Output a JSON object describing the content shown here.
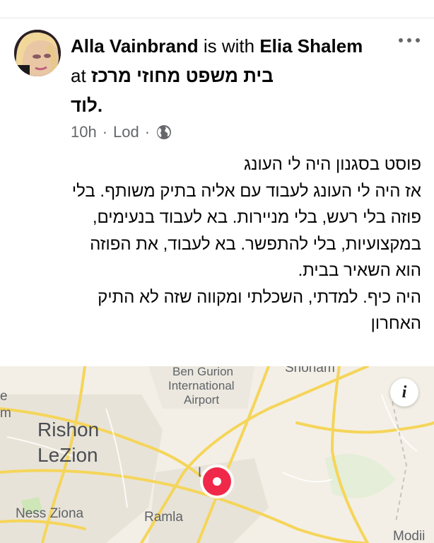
{
  "post": {
    "author": "Alla Vainbrand",
    "is_with": "is with",
    "tagged": "Elia Shalem",
    "at": "at",
    "place_line1": "בית משפט מחוזי מרכז",
    "place_line2": "לוד",
    "place_suffix": ".",
    "time": "10h",
    "separator": "·",
    "location": "Lod",
    "privacy_icon": "globe-icon",
    "body_lines": [
      "פוסט בסגנון היה לי העונג",
      "אז היה לי העונג לעבוד עם אליה בתיק משותף. בלי",
      "פוזה בלי רעש, בלי מניירות. בא לעבוד בנעימים,",
      "במקצועיות, בלי להתפשר. בא לעבוד, את הפוזה",
      "הוא השאיר בבית.",
      "היה כיף. למדתי, השכלתי ומקווה שזה לא התיק",
      "האחרון"
    ]
  },
  "map": {
    "labels": {
      "ben_gurion_1": "Ben Gurion",
      "ben_gurion_2": "International",
      "ben_gurion_3": "Airport",
      "shoham": "Shoham",
      "rishon_1": "Rishon",
      "rishon_2": "LeZion",
      "ness_ziona": "Ness Ziona",
      "ramla": "Ramla",
      "lod": "L",
      "modiin": "Modii",
      "edge_e": "e",
      "edge_m": "m"
    },
    "info_button": "i",
    "colors": {
      "land": "#f3efe6",
      "road": "#f5d55a",
      "urban": "#e6e1d6",
      "green": "#cfe6b8",
      "pin": "#f02849"
    }
  }
}
